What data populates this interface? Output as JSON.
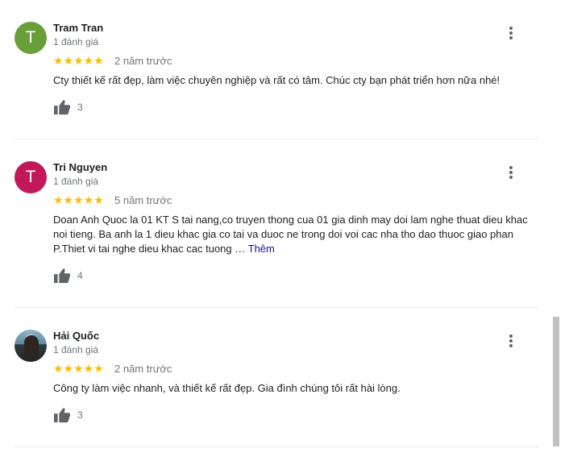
{
  "reviews": [
    {
      "avatar_letter": "T",
      "avatar_color": "#689f38",
      "name": "Tram Tran",
      "review_count": "1 đánh giá",
      "stars": "★★★★★",
      "rating": 5,
      "time": "2 năm trước",
      "text": "Cty thiết kế rất đẹp, làm việc chuyên nghiệp và rất có tâm. Chúc cty bạn phát triển hơn nữa nhé!",
      "more": "",
      "likes": "3"
    },
    {
      "avatar_letter": "T",
      "avatar_color": "#c2185b",
      "name": "Tri Nguyen",
      "review_count": "1 đánh giá",
      "stars": "★★★★★",
      "rating": 5,
      "time": "5 năm trước",
      "text": "Doan Anh Quoc la 01 KT S tai nang,co truyen thong cua 01 gia dinh may doi lam nghe thuat dieu khac noi tieng. Ba anh la 1 dieu khac gia co tai va duoc ne trong doi voi cac nha tho dao thuoc giao phan P.Thiet vi tai nghe dieu khac cac tuong …",
      "more": "Thêm",
      "likes": "4"
    },
    {
      "avatar_letter": "",
      "avatar_color": "",
      "name": "Hải Quốc",
      "review_count": "1 đánh giá",
      "stars": "★★★★★",
      "rating": 5,
      "time": "2 năm trước",
      "text": "Công ty làm việc nhanh, và thiết kế rất đẹp. Gia đình chúng tôi rất hài lòng.",
      "more": "",
      "likes": "3"
    }
  ]
}
